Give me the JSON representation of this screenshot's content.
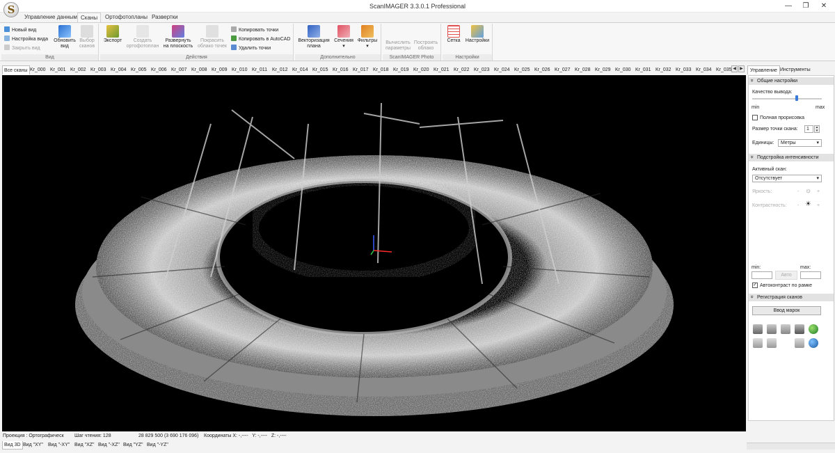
{
  "window": {
    "title": "ScanIMAGER 3.3.0.1 Professional",
    "logo_letter": "S",
    "minimize": "—",
    "maximize": "❐",
    "close": "✕"
  },
  "menu": {
    "tabs": [
      "Управление данными",
      "Сканы",
      "Ортофотопланы",
      "Развертки"
    ]
  },
  "ribbon": {
    "group_view": "Вид",
    "new_view": "Новый вид",
    "view_settings": "Настройка вида",
    "close_view": "Закрыть вид",
    "refresh_view_1": "Обновить",
    "refresh_view_2": "вид",
    "select_scans_1": "Выбор",
    "select_scans_2": "сканов",
    "group_actions": "Действия",
    "export": "Экспорт",
    "create_ortho_1": "Создать",
    "create_ortho_2": "ортофотоплан",
    "unfold_1": "Развернуть",
    "unfold_2": "на плоскость",
    "paint_1": "Покрасить",
    "paint_2": "облако точек",
    "copy_points": "Копировать точки",
    "copy_autocad": "Копировать в AutoCAD",
    "delete_points": "Удалить точки",
    "group_extra": "Дополнительно",
    "vectorize_1": "Векторизация",
    "vectorize_2": "плана",
    "sections": "Сечения",
    "filters": "Фильтры",
    "group_photo": "ScanIMAGER Photo",
    "calc_params_1": "Вычислить",
    "calc_params_2": "параметры",
    "build_cloud_1": "Построить",
    "build_cloud_2": "облако",
    "group_settings": "Настройки",
    "grid": "Сетка",
    "settings": "Настройки"
  },
  "scan_tabs": [
    "Все сканы",
    "Kr_000",
    "Kr_001",
    "Kr_002",
    "Kr_003",
    "Kr_004",
    "Kr_005",
    "Kr_006",
    "Kr_007",
    "Kr_008",
    "Kr_009",
    "Kr_010",
    "Kr_011",
    "Kr_012",
    "Kr_014",
    "Kr_015",
    "Kr_016",
    "Kr_017",
    "Kr_018",
    "Kr_019",
    "Kr_020",
    "Kr_021",
    "Kr_022",
    "Kr_023",
    "Kr_024",
    "Kr_025",
    "Kr_026",
    "Kr_027",
    "Kr_028",
    "Kr_029",
    "Kr_030",
    "Kr_031",
    "Kr_032",
    "Kr_033",
    "Kr_034",
    "Kr_035"
  ],
  "scroll": {
    "left": "◀",
    "right": "▶"
  },
  "status": {
    "projection": "Проекция : Ортографическ",
    "read_step": "Шаг чтения: 128",
    "points": "28 829 500 (3 690 176 096)",
    "coords": "Координаты X: -,----   Y: -,----   Z: -,----"
  },
  "view_tabs": [
    "Вид 3D",
    "Вид \"XY\"",
    "Вид \"-XY\"",
    "Вид \"XZ\"",
    "Вид \"-XZ\"",
    "Вид \"YZ\"",
    "Вид \"-YZ\""
  ],
  "panel": {
    "tabs": [
      "Управление",
      "Инструменты"
    ],
    "general_header": "Общие настройки",
    "quality_label": "Качество вывода:",
    "quality_min": "min",
    "quality_max": "max",
    "quality_level": 0.64,
    "full_render": "Полная прорисовка",
    "point_size_label": "Размер точки скана:",
    "point_size": "1",
    "units_label": "Единицы:",
    "units": "Метры",
    "intensity_header": "Подстройка интенсивности",
    "active_scan_label": "Активный скан:",
    "active_scan": "Отсутствует",
    "brightness": "Яркость:",
    "contrast": "Контрастность:",
    "min_label": "min:",
    "max_label": "max:",
    "auto": "Авто",
    "autocontrast": "Автоконтраст по рамке",
    "registration_header": "Регистрация сканов",
    "enter_marks": "Ввод марок"
  }
}
